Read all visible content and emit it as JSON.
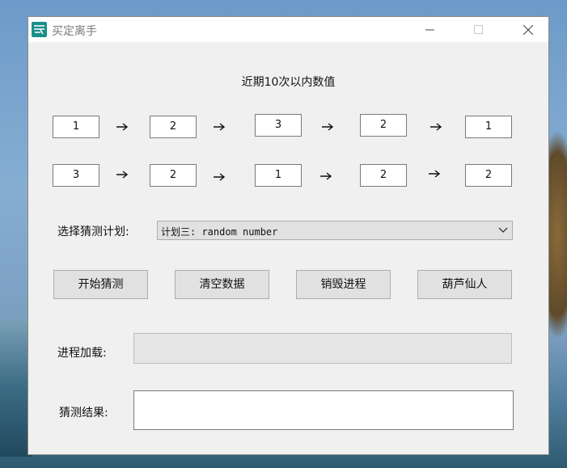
{
  "window": {
    "title": "买定离手"
  },
  "heading": "近期10次以内数值",
  "rows": [
    [
      "1",
      "2",
      "3",
      "2",
      "1"
    ],
    [
      "3",
      "2",
      "1",
      "2",
      "2"
    ]
  ],
  "plan": {
    "label": "选择猜测计划:",
    "selected": "计划三: random number"
  },
  "buttons": {
    "start": "开始猜测",
    "clear": "清空数据",
    "destroy": "销毁进程",
    "gourd": "葫芦仙人"
  },
  "progress": {
    "label": "进程加载:",
    "value": 0
  },
  "result": {
    "label": "猜测结果:",
    "value": ""
  }
}
